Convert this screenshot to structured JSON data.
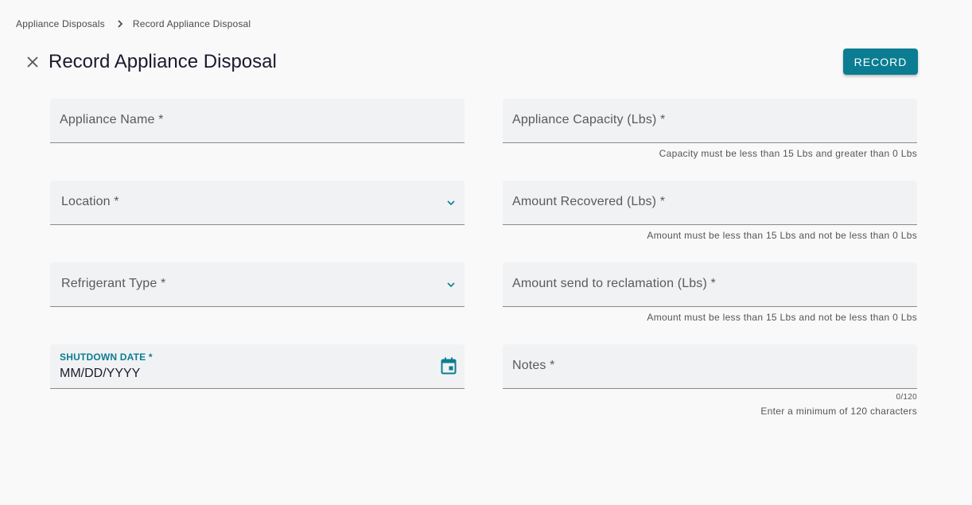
{
  "breadcrumb": {
    "items": [
      "Appliance Disposals",
      "Record Appliance Disposal"
    ]
  },
  "header": {
    "title": "Record Appliance Disposal",
    "record_label": "RECORD"
  },
  "colors": {
    "accent": "#0b7d92",
    "background": "#f9f9f9",
    "field_bg": "#f1f2f4"
  },
  "form": {
    "appliance_name": {
      "label": "Appliance Name *"
    },
    "location": {
      "label": "Location *"
    },
    "refrigerant_type": {
      "label": "Refrigerant Type *"
    },
    "shutdown_date": {
      "label": "SHUTDOWN DATE *",
      "value": "MM/DD/YYYY"
    },
    "appliance_capacity": {
      "label": "Appliance Capacity (Lbs) *",
      "hint": "Capacity must be less than 15 Lbs and greater than 0 Lbs"
    },
    "amount_recovered": {
      "label": "Amount Recovered (Lbs) *",
      "hint": "Amount must be less than 15 Lbs and not be less than 0 Lbs"
    },
    "amount_reclamation": {
      "label": "Amount send to reclamation (Lbs) *",
      "hint": "Amount must be less than 15 Lbs and not be less than 0 Lbs"
    },
    "notes": {
      "label": "Notes *",
      "counter": "0/120",
      "hint": "Enter a minimum of 120 characters"
    }
  }
}
